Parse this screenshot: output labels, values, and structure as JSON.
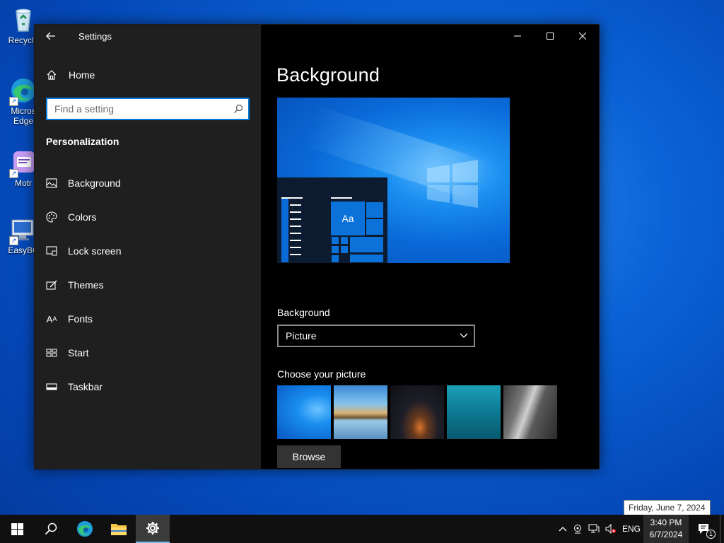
{
  "desktop": {
    "icons": [
      {
        "label": "Recycle",
        "icon": "recycle-bin-icon"
      },
      {
        "label": "Micros Edge",
        "icon": "edge-icon"
      },
      {
        "label": "Motr",
        "icon": "app-icon"
      },
      {
        "label": "EasyBC",
        "icon": "easybcd-icon"
      }
    ]
  },
  "window": {
    "title": "Settings",
    "home_label": "Home",
    "search_placeholder": "Find a setting",
    "section_title": "Personalization",
    "nav": [
      {
        "label": "Background",
        "icon": "picture-icon"
      },
      {
        "label": "Colors",
        "icon": "palette-icon"
      },
      {
        "label": "Lock screen",
        "icon": "lock-screen-icon"
      },
      {
        "label": "Themes",
        "icon": "themes-icon"
      },
      {
        "label": "Fonts",
        "icon": "fonts-icon"
      },
      {
        "label": "Start",
        "icon": "start-icon"
      },
      {
        "label": "Taskbar",
        "icon": "taskbar-icon"
      }
    ]
  },
  "content": {
    "title": "Background",
    "preview_tile_text": "Aa",
    "background_label": "Background",
    "background_value": "Picture",
    "choose_label": "Choose your picture",
    "browse_label": "Browse"
  },
  "taskbar": {
    "language": "ENG",
    "time": "3:40 PM",
    "date": "6/7/2024",
    "tooltip": "Friday, June 7, 2024",
    "notification_count": "1"
  },
  "colors": {
    "accent": "#0078d7",
    "sidebar_bg": "#1f1f1f",
    "content_bg": "#000000"
  }
}
